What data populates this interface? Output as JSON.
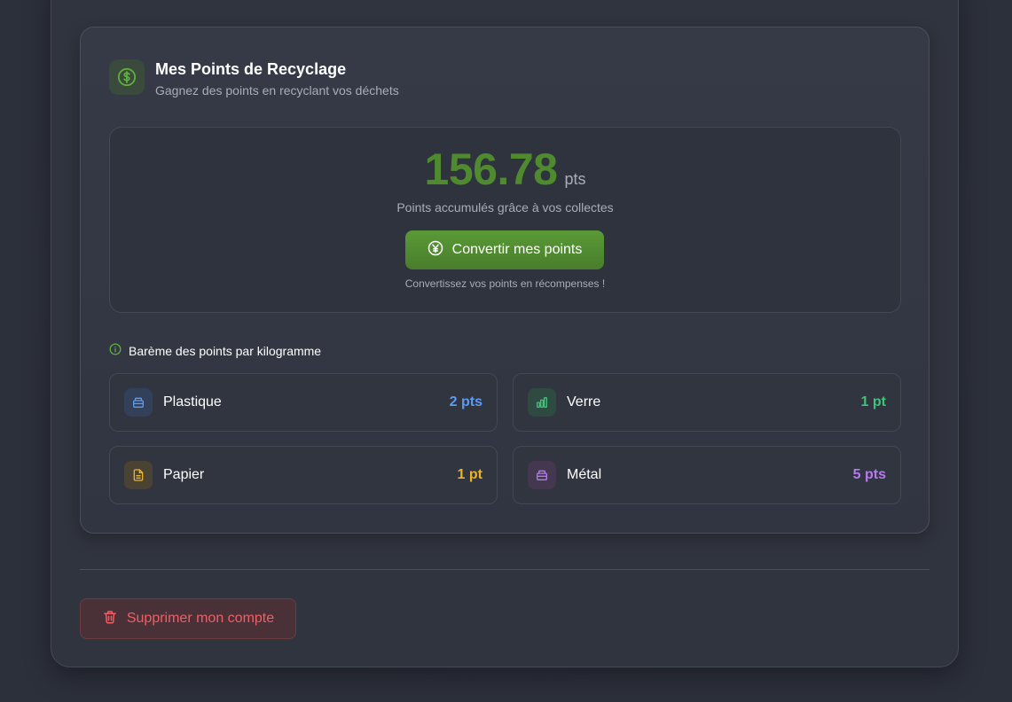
{
  "points_card": {
    "title": "Mes Points de Recyclage",
    "subtitle": "Gagnez des points en recyclant vos déchets",
    "icon": "dollar-circle-icon"
  },
  "score": {
    "value": "156.78",
    "unit": "pts",
    "caption": "Points accumulés grâce à vos collectes",
    "convert_label": "Convertir mes points",
    "convert_icon": "yen-circle-icon",
    "hint": "Convertissez vos points en récompenses !"
  },
  "scale": {
    "heading": "Barème des points par kilogramme",
    "materials": [
      {
        "label": "Plastique",
        "points": "2 pts",
        "color": "#5b9cf0",
        "icon": "container-icon"
      },
      {
        "label": "Verre",
        "points": "1 pt",
        "color": "#3fc37a",
        "icon": "bar-chart-icon"
      },
      {
        "label": "Papier",
        "points": "1 pt",
        "color": "#eab32a",
        "icon": "document-icon"
      },
      {
        "label": "Métal",
        "points": "5 pts",
        "color": "#b879f0",
        "icon": "container-icon"
      }
    ]
  },
  "account": {
    "delete_label": "Supprimer mon compte",
    "delete_icon": "trash-icon"
  },
  "colors": {
    "accent_green": "#4f8a2e",
    "danger": "#ef5f66"
  }
}
